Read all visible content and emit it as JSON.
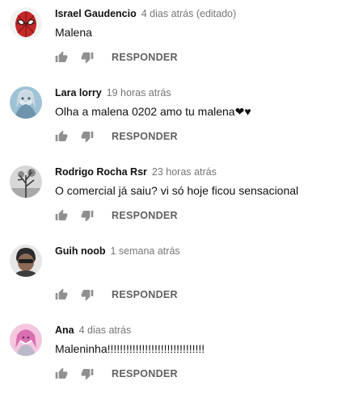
{
  "comments": [
    {
      "author": "Israel Gaudencio",
      "time": "4 dias atrás (editado)",
      "text": "Malena",
      "avatar": "spiderman-mask-avatar",
      "reply_label": "RESPONDER"
    },
    {
      "author": "Lara lorry",
      "time": "19 horas atrás",
      "text": "Olha a malena 0202 amo tu malena❤♥",
      "avatar": "anime-character-avatar",
      "reply_label": "RESPONDER"
    },
    {
      "author": "Rodrigo Rocha Rsr",
      "time": "23 horas atrás",
      "text": "O comercial já saiu? vi só hoje ficou sensacional",
      "avatar": "tree-silhouette-avatar",
      "reply_label": "RESPONDER"
    },
    {
      "author": "Guih noob",
      "time": "1 semana atrás",
      "text": "",
      "avatar": "person-photo-avatar",
      "reply_label": "RESPONDER"
    },
    {
      "author": "Ana",
      "time": "4 dias atrás",
      "text": "Maleninha!!!!!!!!!!!!!!!!!!!!!!!!!!!!!!!",
      "avatar": "pink-character-avatar",
      "reply_label": "RESPONDER"
    }
  ],
  "colors": {
    "author": "#111111",
    "time": "#767676",
    "action": "#606060"
  },
  "icons": [
    "thumbs-up-icon",
    "thumbs-down-icon"
  ]
}
